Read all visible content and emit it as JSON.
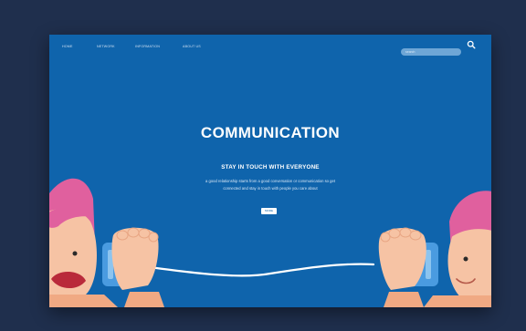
{
  "nav": {
    "items": [
      {
        "label": "Home"
      },
      {
        "label": "Network"
      },
      {
        "label": "Information"
      },
      {
        "label": "About us"
      }
    ]
  },
  "search": {
    "placeholder": "search"
  },
  "hero": {
    "title": "COMMUNICATION",
    "subtitle": "STAY IN TOUCH WITH EVERYONE",
    "description": "a good relationship starts from a good conversation or communication so get connected and stay in touch with people you care about",
    "button_label": "more"
  },
  "colors": {
    "page_bg": "#1f2f4d",
    "hero_bg": "#0f64ac",
    "hair": "#e0609e",
    "skin": "#f6c3a4",
    "can": "#4a9be0"
  },
  "icons": [
    "search-icon"
  ]
}
